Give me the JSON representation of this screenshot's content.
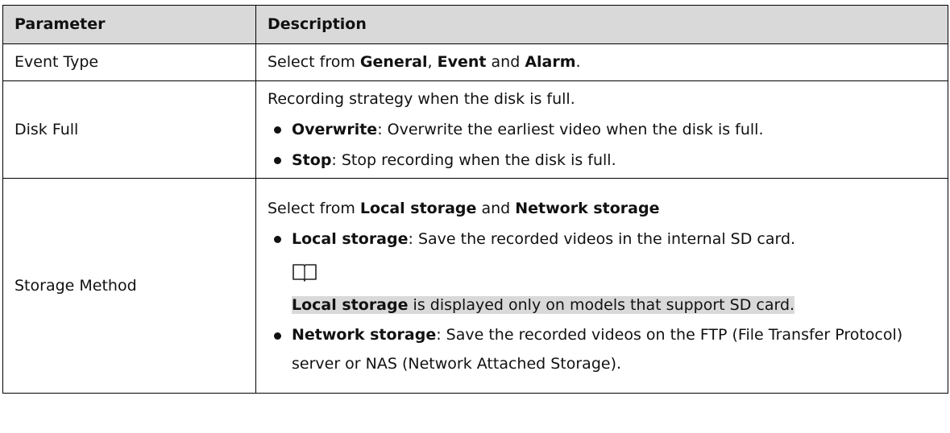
{
  "header": {
    "parameter": "Parameter",
    "description": "Description"
  },
  "rows": {
    "event_type": {
      "parameter": "Event Type",
      "desc_pre": "Select from ",
      "opt1": "General",
      "sep": ", ",
      "opt2": "Event",
      "and": " and ",
      "opt3": "Alarm",
      "end": "."
    },
    "disk_full": {
      "parameter": "Disk Full",
      "intro": "Recording strategy when the disk is full.",
      "bullets": [
        {
          "term": "Overwrite",
          "text": ": Overwrite the earliest video when the disk is full."
        },
        {
          "term": "Stop",
          "text": ": Stop recording when the disk is full."
        }
      ]
    },
    "storage_method": {
      "parameter": "Storage Method",
      "intro_pre": "Select from ",
      "opt1": "Local storage",
      "and": " and ",
      "opt2": "Network storage",
      "bullet1_term": "Local storage",
      "bullet1_text": ": Save the recorded videos in the internal SD card.",
      "note_icon": "book-icon",
      "note_term": "Local storage",
      "note_text": " is displayed only on models that support SD card.",
      "bullet2_term": "Network storage",
      "bullet2_text": ": Save the recorded videos on the FTP (File Transfer Protocol) server or NAS (Network Attached Storage)."
    }
  }
}
